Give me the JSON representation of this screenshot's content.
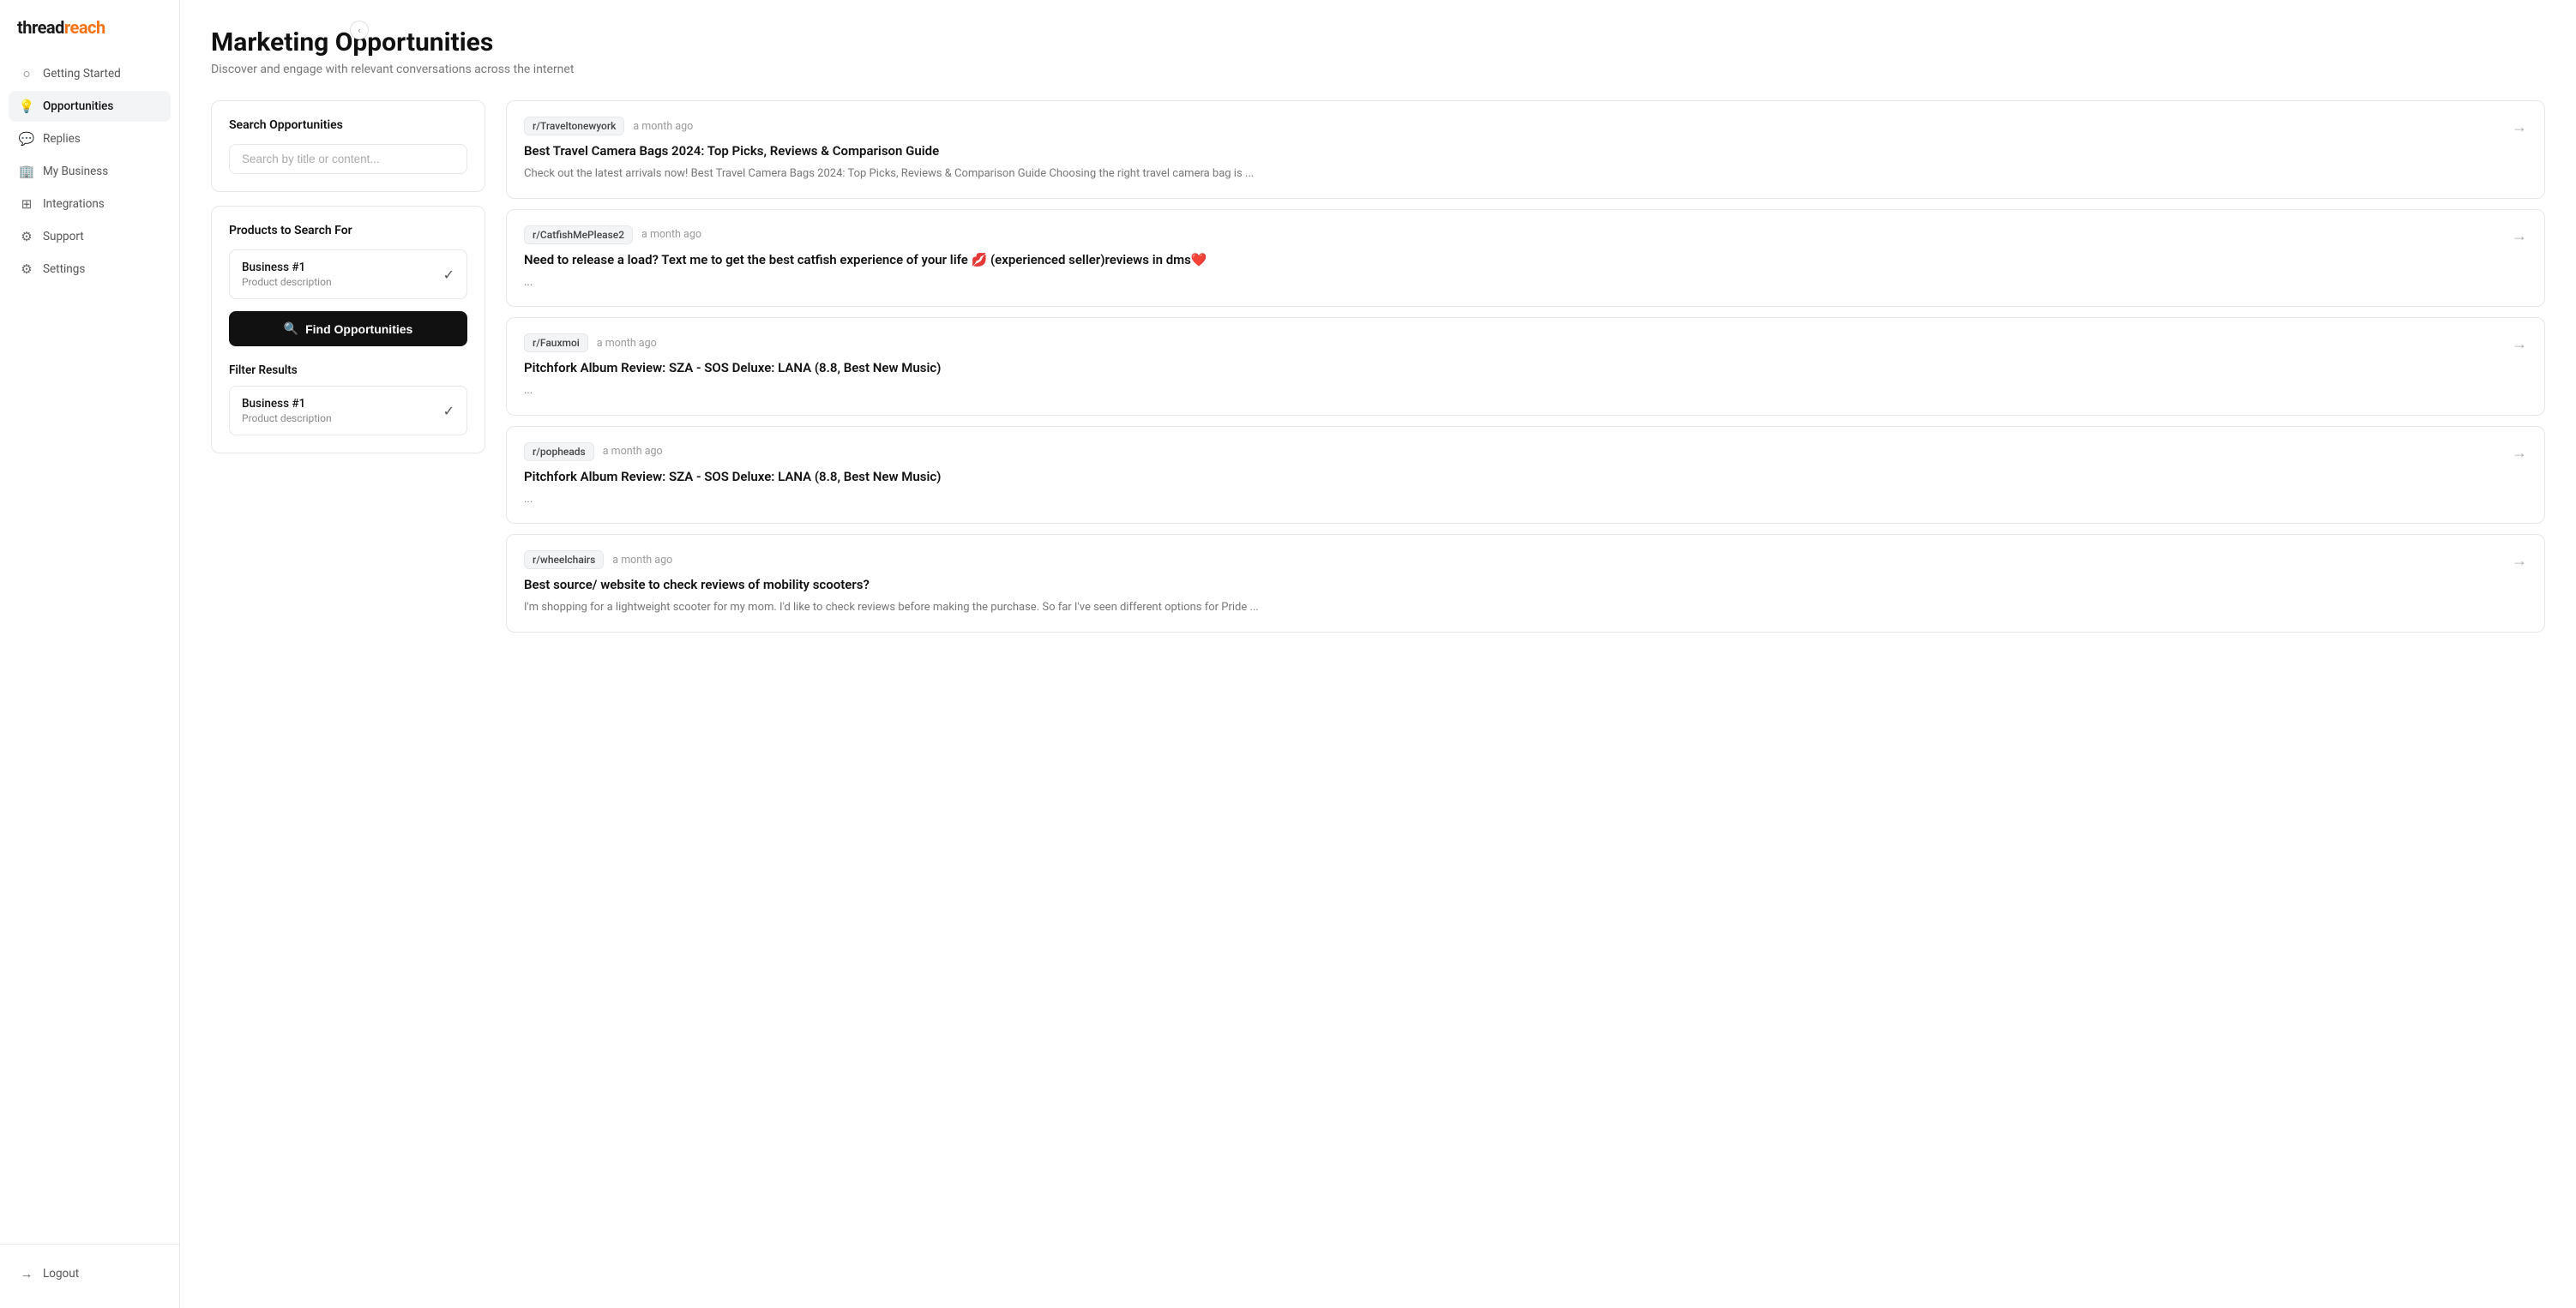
{
  "brand": {
    "name_part1": "thread",
    "name_part2": "reach"
  },
  "sidebar": {
    "collapse_icon": "‹",
    "items": [
      {
        "id": "getting-started",
        "label": "Getting Started",
        "icon": "circle"
      },
      {
        "id": "opportunities",
        "label": "Opportunities",
        "icon": "lightbulb",
        "active": true
      },
      {
        "id": "replies",
        "label": "Replies",
        "icon": "chat"
      },
      {
        "id": "my-business",
        "label": "My Business",
        "icon": "briefcase"
      },
      {
        "id": "integrations",
        "label": "Integrations",
        "icon": "grid"
      },
      {
        "id": "support",
        "label": "Support",
        "icon": "question"
      },
      {
        "id": "settings",
        "label": "Settings",
        "icon": "gear"
      }
    ],
    "logout_label": "Logout"
  },
  "page": {
    "title": "Marketing Opportunities",
    "subtitle": "Discover and engage with relevant conversations across the internet"
  },
  "search_panel": {
    "title": "Search Opportunities",
    "input_placeholder": "Search by title or content..."
  },
  "products_panel": {
    "title": "Products to Search For",
    "items": [
      {
        "name": "Business #1",
        "desc": "Product description",
        "checked": true
      }
    ]
  },
  "find_button": {
    "label": "Find Opportunities",
    "icon": "🔍"
  },
  "filter_panel": {
    "title": "Filter Results",
    "items": [
      {
        "name": "Business #1",
        "desc": "Product description",
        "checked": true
      }
    ]
  },
  "results": [
    {
      "id": 1,
      "subreddit": "r/Traveltonewyork",
      "time_ago": "a month ago",
      "title": "Best Travel Camera Bags 2024: Top Picks, Reviews & Comparison Guide",
      "snippet": "Check out the latest arrivals now! Best Travel Camera Bags 2024: Top Picks, Reviews & Comparison Guide Choosing the right travel camera bag is ..."
    },
    {
      "id": 2,
      "subreddit": "r/CatfishMePlease2",
      "time_ago": "a month ago",
      "title": "Need to release a load? Text me to get the best catfish experience of your life 💋 (experienced seller)reviews in dms❤️",
      "snippet": "..."
    },
    {
      "id": 3,
      "subreddit": "r/Fauxmoi",
      "time_ago": "a month ago",
      "title": "Pitchfork Album Review: SZA - SOS Deluxe: LANA (8.8, Best New Music)",
      "snippet": "..."
    },
    {
      "id": 4,
      "subreddit": "r/popheads",
      "time_ago": "a month ago",
      "title": "Pitchfork Album Review: SZA - SOS Deluxe: LANA (8.8, Best New Music)",
      "snippet": "..."
    },
    {
      "id": 5,
      "subreddit": "r/wheelchairs",
      "time_ago": "a month ago",
      "title": "Best source/ website to check reviews of mobility scooters?",
      "snippet": "I'm shopping for a lightweight scooter for my mom. I'd like to check reviews before making the purchase. So far I've seen different options for Pride ..."
    }
  ]
}
